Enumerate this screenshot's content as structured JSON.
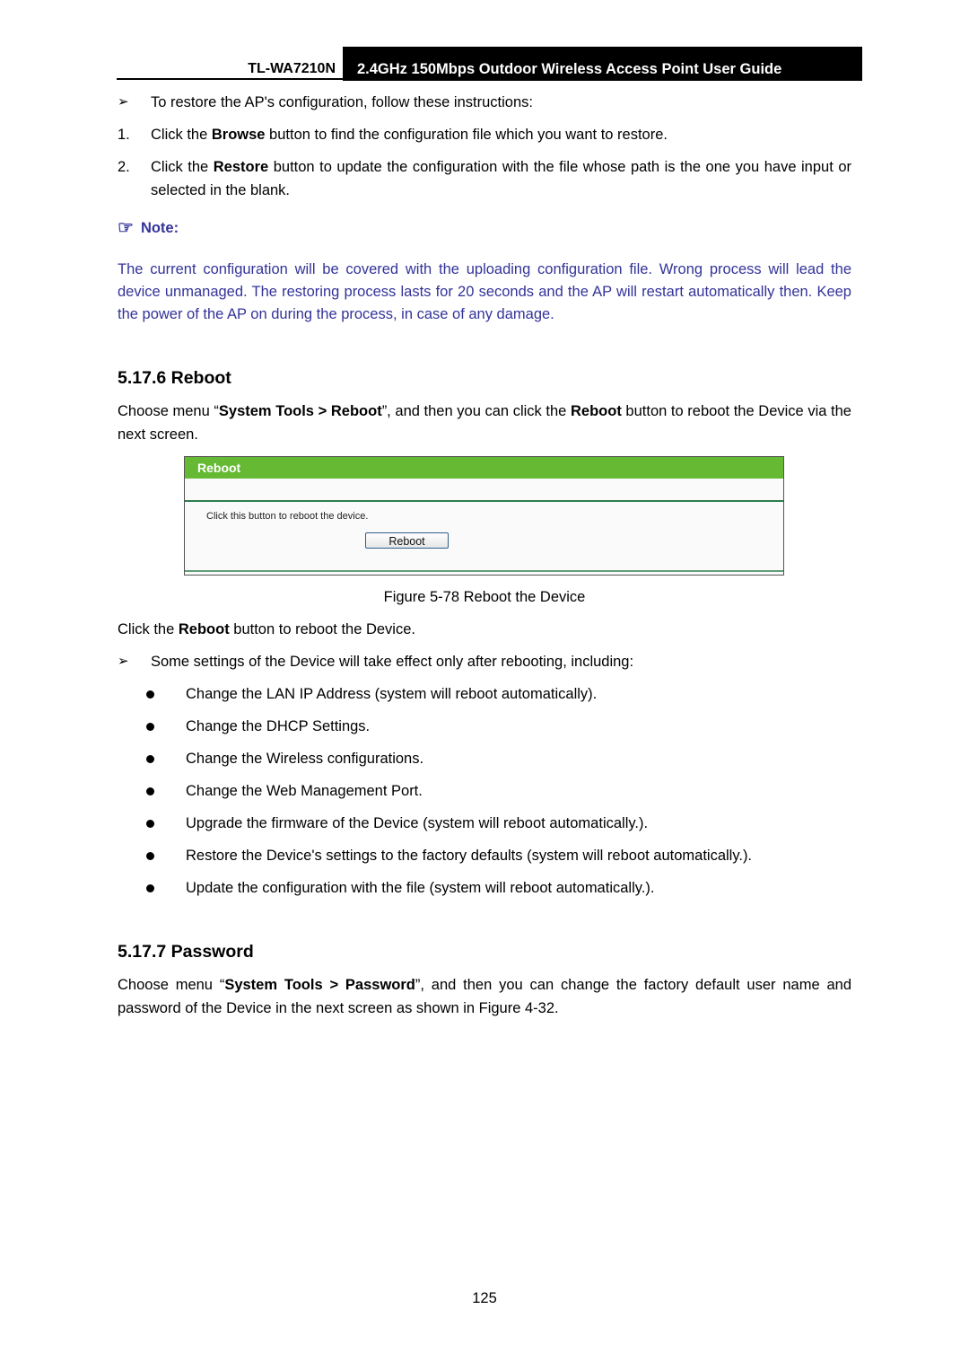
{
  "header": {
    "model": "TL-WA7210N",
    "title": "2.4GHz 150Mbps Outdoor Wireless Access Point User Guide"
  },
  "restore": {
    "intro_marker": "arrow-bullet",
    "intro": "To restore the AP's configuration, follow these instructions:",
    "steps": [
      {
        "num": "1.",
        "pre": "Click the ",
        "bold": "Browse",
        "post": " button to find the configuration file which you want to restore."
      },
      {
        "num": "2.",
        "pre": "Click the ",
        "bold": "Restore",
        "post": " button to update the configuration with the file whose path is the one you have input or selected in the blank."
      }
    ]
  },
  "note": {
    "icon": "pointing-hand-icon",
    "label": "Note:",
    "text": "The current configuration will be covered with the uploading configuration file. Wrong process will lead the device unmanaged. The restoring process lasts for 20 seconds and the AP will restart automatically then. Keep the power of the AP on during the process, in case of any damage.",
    "color": "#333399"
  },
  "reboot_section": {
    "heading": "5.17.6 Reboot",
    "intro_pre": "Choose menu “",
    "intro_bold1": "System Tools > Reboot",
    "intro_mid": "”, and then you can click the ",
    "intro_bold2": "Reboot",
    "intro_post": " button to reboot the Device via the next screen.",
    "figure": {
      "panel_title": "Reboot",
      "description": "Click this button to reboot the device.",
      "button_label": "Reboot",
      "accent_color": "#66b933"
    },
    "caption": "Figure 5-78 Reboot the Device",
    "after_pre": "Click the ",
    "after_bold": "Reboot",
    "after_post": " button to reboot the Device.",
    "settings_intro": "Some settings of the Device will take effect only after rebooting, including:",
    "settings": [
      "Change the LAN IP Address (system will reboot automatically).",
      "Change the DHCP Settings.",
      "Change the Wireless configurations.",
      "Change the Web Management Port.",
      "Upgrade the firmware of the Device (system will reboot automatically.).",
      "Restore the Device's settings to the factory defaults (system will reboot automatically.).",
      "Update the configuration with the file (system will reboot automatically.)."
    ]
  },
  "password_section": {
    "heading": "5.17.7 Password",
    "intro_pre": "Choose menu “",
    "intro_bold": "System Tools > Password",
    "intro_post": "”, and then you can change the factory default user name and password of the Device in the next screen as shown in Figure 4-32."
  },
  "page_number": "125"
}
